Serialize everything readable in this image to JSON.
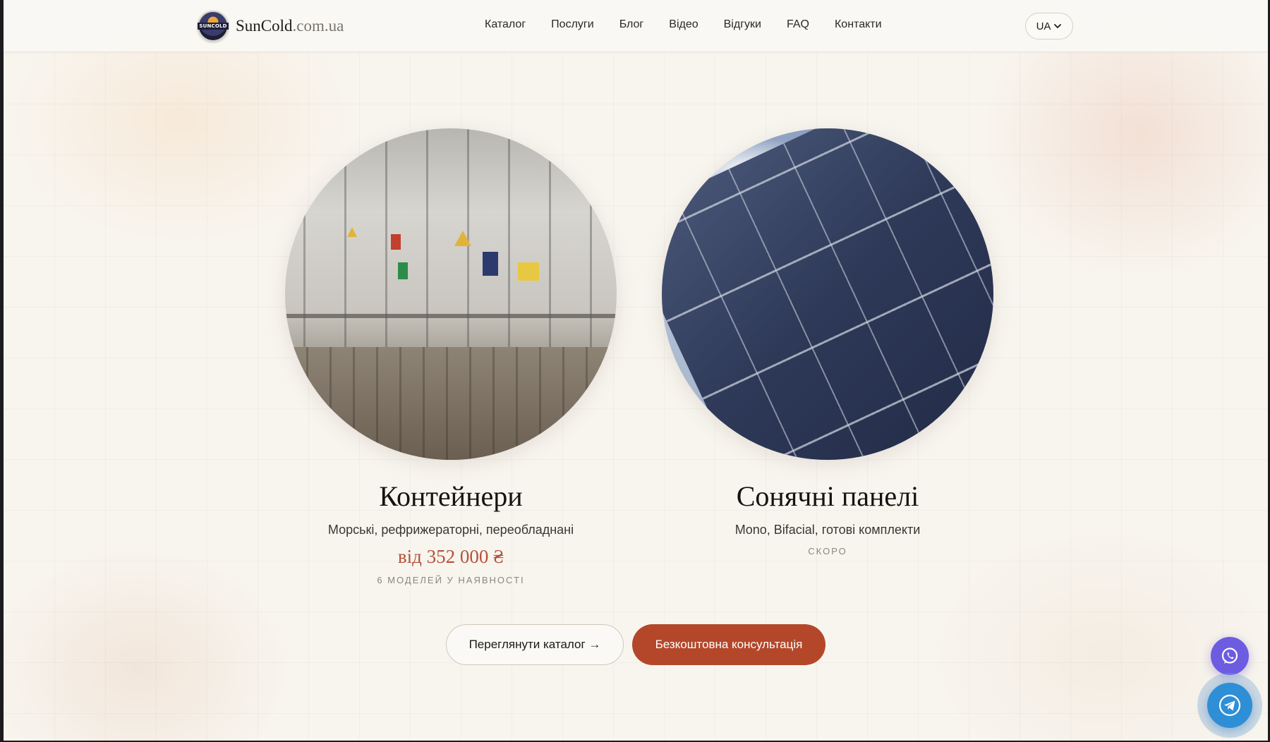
{
  "header": {
    "logo_badge_text": "SUNCOLD",
    "brand_name": "SunCold",
    "brand_domain": ".com.ua",
    "nav": [
      {
        "label": "Каталог"
      },
      {
        "label": "Послуги"
      },
      {
        "label": "Блог"
      },
      {
        "label": "Відео"
      },
      {
        "label": "Відгуки"
      },
      {
        "label": "FAQ"
      },
      {
        "label": "Контакти"
      }
    ],
    "language": "UA",
    "language_icon": "chevron-down-icon"
  },
  "cards": [
    {
      "title": "Контейнери",
      "subtitle": "Морські, рефрижераторні, переобладнані",
      "price": "від 352 000 ₴",
      "note": "6 МОДЕЛЕЙ У НАЯВНОСТІ"
    },
    {
      "title": "Сонячні панелі",
      "subtitle": "Mono, Bifacial, готові комплекти",
      "note": "СКОРО"
    }
  ],
  "actions": {
    "catalog_label": "Переглянути каталог →",
    "consult_label": "Безкоштовна консультація"
  },
  "floating": {
    "whatsapp_icon": "whatsapp-icon",
    "telegram_icon": "telegram-icon"
  },
  "colors": {
    "accent": "#b4472a",
    "price": "#b4523a",
    "whatsapp": "#6d5ce0",
    "telegram": "#2e8fd6",
    "background": "#f8f5ef"
  }
}
